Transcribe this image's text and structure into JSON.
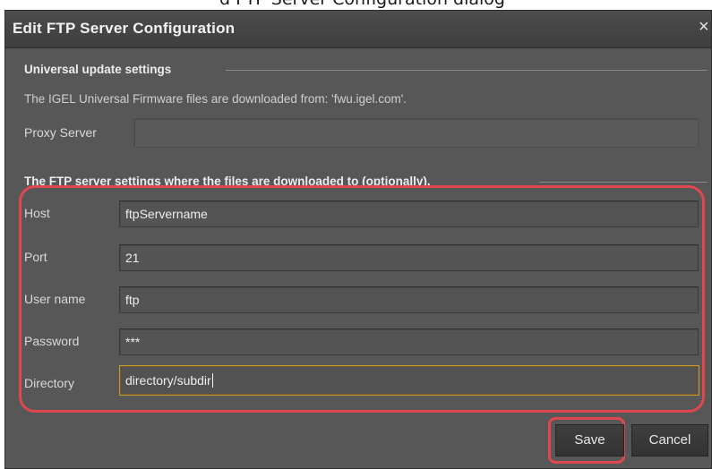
{
  "page_caption": "d FTP Server Configuration dialog",
  "dialog": {
    "title": "Edit FTP Server Configuration",
    "close_symbol": "×"
  },
  "universal_section": {
    "title": "Universal update settings",
    "info": "The IGEL Universal Firmware files are downloaded from: 'fwu.igel.com'.",
    "proxy_label": "Proxy Server",
    "proxy_value": ""
  },
  "ftp_section": {
    "title": "The FTP server settings where the files are downloaded to (optionally).",
    "fields": [
      {
        "label": "Host",
        "value": "ftpServername"
      },
      {
        "label": "Port",
        "value": "21"
      },
      {
        "label": "User name",
        "value": "ftp"
      },
      {
        "label": "Password",
        "value": "***"
      },
      {
        "label": "Directory",
        "value": "directory/subdir"
      }
    ]
  },
  "buttons": {
    "save": "Save",
    "cancel": "Cancel"
  },
  "colors": {
    "dialog_background": "#575757",
    "title_bar": "#444444",
    "highlight": "#e0474f",
    "focus_border": "#c99a2e"
  },
  "icons": {
    "close": "close-icon"
  }
}
